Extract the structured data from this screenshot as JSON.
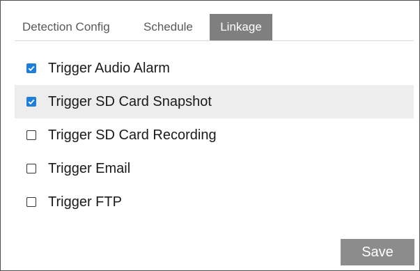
{
  "tabs": [
    {
      "label": "Detection Config",
      "active": false
    },
    {
      "label": "Schedule",
      "active": false
    },
    {
      "label": "Linkage",
      "active": true
    }
  ],
  "options": [
    {
      "label": "Trigger Audio Alarm",
      "checked": true
    },
    {
      "label": "Trigger SD Card Snapshot",
      "checked": true
    },
    {
      "label": "Trigger SD Card Recording",
      "checked": false
    },
    {
      "label": "Trigger Email",
      "checked": false
    },
    {
      "label": "Trigger FTP",
      "checked": false
    }
  ],
  "save_label": "Save",
  "colors": {
    "accent": "#1e7ed9",
    "active_tab": "#7f7f7f",
    "save_button": "#8c8c8c",
    "row_highlight": "#ededed"
  }
}
